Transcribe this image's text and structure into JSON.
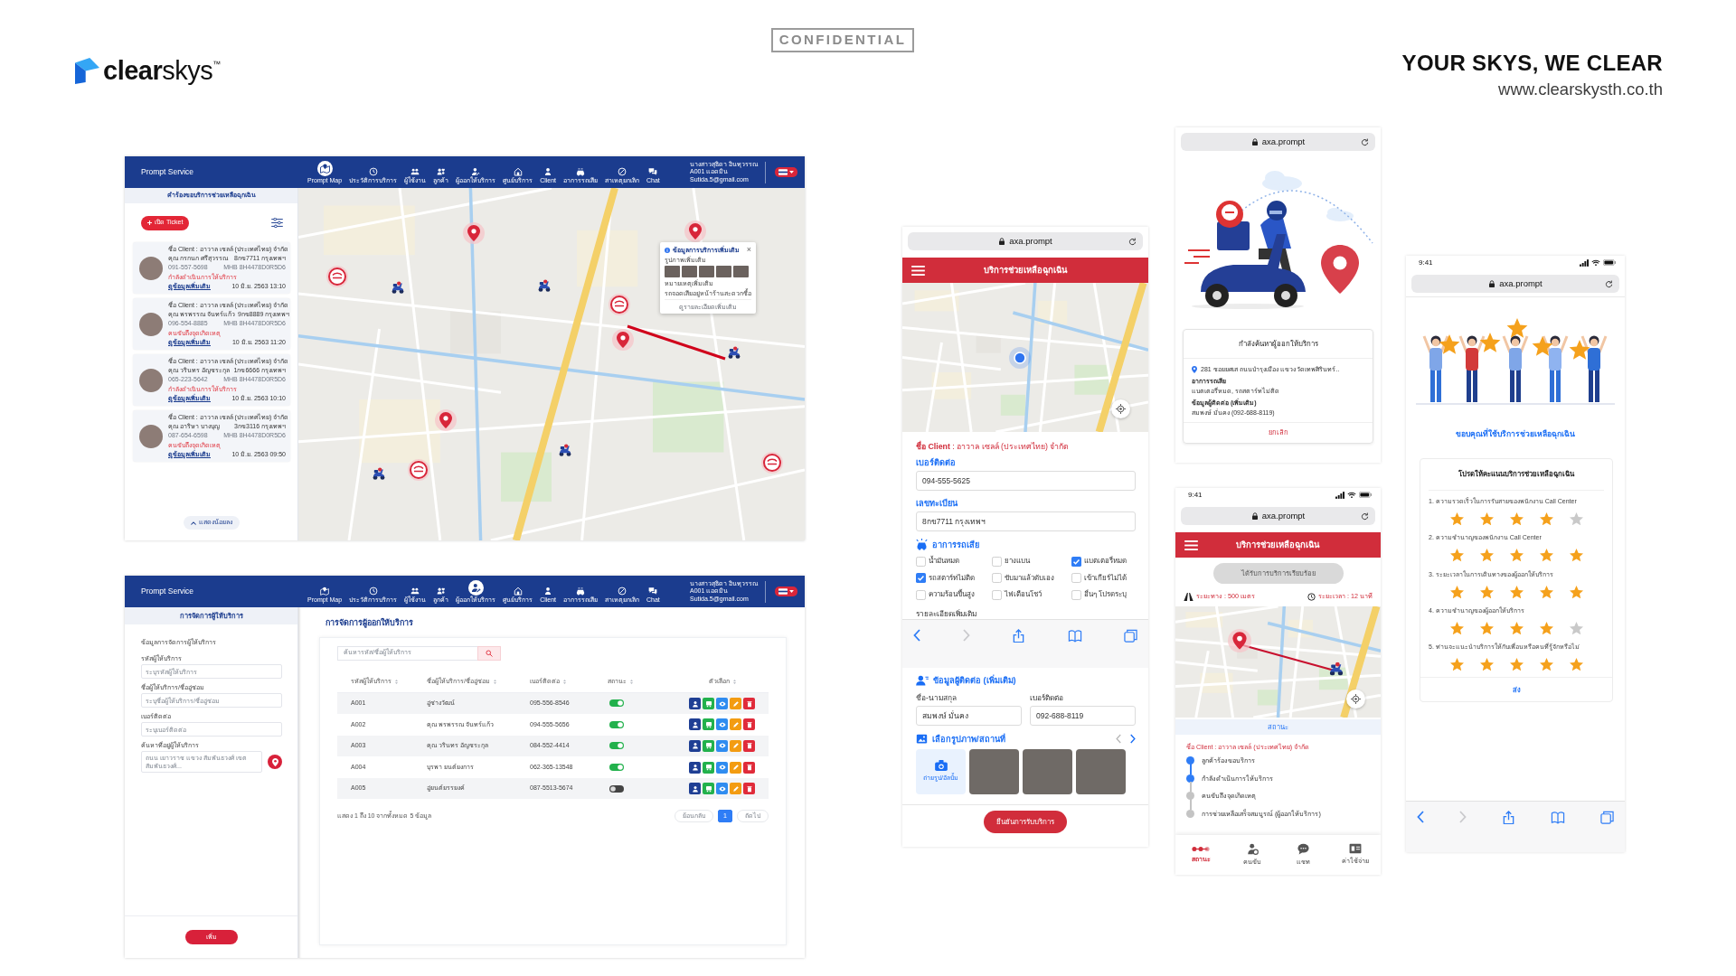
{
  "slide": {
    "logo": "**clear**skys$^{™}$",
    "confidential": "CONFIDENTIAL",
    "tagline": "YOUR SKYS, WE CLEAR",
    "website": "www.clearskysth.co.th"
  },
  "desktop_screens": [
    {
      "kind": "map",
      "app_title": "Prompt Service",
      "nav": [
        {
          "label": "Prompt Map",
          "selected": true
        },
        {
          "label": "ประวัติการบริการ",
          "selected": false
        },
        {
          "label": "ผู้ใช้งาน",
          "selected": false
        },
        {
          "label": "ลูกค้า",
          "selected": false
        },
        {
          "label": "ผู้ออกให้บริการ",
          "selected": false
        },
        {
          "label": "ศูนย์บริการ",
          "selected": false
        },
        {
          "label": "Client",
          "selected": false
        },
        {
          "label": "อาการรถเสีย",
          "selected": false
        },
        {
          "label": "สาเหตุยกเลิก",
          "selected": false
        },
        {
          "label": "Chat",
          "selected": false
        }
      ],
      "user": [
        "นางสาวสุธิดา อินทุวรรณ",
        "A001 แอดมิน",
        "Sutida.5@gmail.com"
      ],
      "sidebar": {
        "title": "คำร้องขอบริการช่วยเหลือฉุกเฉิน",
        "ticket_button": "เปิด Ticket",
        "requests": [
          {
            "client": "ชื่อ Client : อาวาล เซลล์ (ประเทศไทย) จำกัด",
            "name": "คุณ กรกนก ศรีสุวรรณ",
            "plate": "8กข7711 กรุงเทพฯ",
            "phone": "091-557-5698",
            "vin": "MHB 8H4478D0R5D6",
            "status": "กำลังดำเนินการให้บริการ",
            "link": "ดูข้อมูลเพิ่มเติม",
            "date": "10 มิ.ย. 2563 13:10"
          },
          {
            "client": "ชื่อ Client : อาวาล เซลล์ (ประเทศไทย) จำกัด",
            "name": "คุณ พรพรรณ จันทร์แก้ว",
            "plate": "9กข8889 กรุงเทพฯ",
            "phone": "096-554-8885",
            "vin": "MHB 8H4478D0R5D6",
            "status": "คนขับถึงจุดเกิดเหตุ",
            "link": "ดูข้อมูลเพิ่มเติม",
            "date": "10 มิ.ย. 2563 11:20"
          },
          {
            "client": "ชื่อ Client : อาวาล เซลล์ (ประเทศไทย) จำกัด",
            "name": "คุณ วรินทร อัญชระกุล",
            "plate": "1กข6666 กรุงเทพฯ",
            "phone": "065-223-5642",
            "vin": "MHB 8H4478D0R5D6",
            "status": "กำลังดำเนินการให้บริการ",
            "link": "ดูข้อมูลเพิ่มเติม",
            "date": "10 มิ.ย. 2563 10:10"
          },
          {
            "client": "ชื่อ Client : อาวาล เซลล์ (ประเทศไทย) จำกัด",
            "name": "คุณ อาริษา บางบุญ",
            "plate": "3กข3116 กรุงเทพฯ",
            "phone": "087-654-6598",
            "vin": "MHB 8H4478D0R5D6",
            "status": "คนขับถึงจุดเกิดเหตุ",
            "link": "ดูข้อมูลเพิ่มเติม",
            "date": "10 มิ.ย. 2563 09:50"
          }
        ],
        "collapse_button": "แสดงน้อยลง"
      },
      "map_popup": {
        "title": "ข้อมูลการบริการเพิ่มเติม",
        "close": "×",
        "photos_label": "รูปภาพเพิ่มเติม",
        "note_label": "หมายเหตุเพิ่มเติม",
        "note": "รถจอดเสียอยู่หน้าร้านสะดวกซื้อ",
        "link": "ดูรายละเอียดเพิ่มเติม"
      }
    },
    {
      "kind": "providers",
      "app_title": "Prompt Service",
      "nav": [
        {
          "label": "Prompt Map",
          "selected": false
        },
        {
          "label": "ประวัติการบริการ",
          "selected": false
        },
        {
          "label": "ผู้ใช้งาน",
          "selected": false
        },
        {
          "label": "ลูกค้า",
          "selected": false
        },
        {
          "label": "ผู้ออกให้บริการ",
          "selected": true
        },
        {
          "label": "ศูนย์บริการ",
          "selected": false
        },
        {
          "label": "Client",
          "selected": false
        },
        {
          "label": "อาการรถเสีย",
          "selected": false
        },
        {
          "label": "สาเหตุยกเลิก",
          "selected": false
        },
        {
          "label": "Chat",
          "selected": false
        }
      ],
      "user": [
        "นางสาวสุธิดา อินทุวรรณ",
        "A001 แอดมิน",
        "Sutida.5@gmail.com"
      ],
      "sidebar": {
        "title": "การจัดการผู้ให้บริการ",
        "form_title": "ข้อมูลการจัดการผู้ให้บริการ",
        "fields": [
          {
            "label": "รหัสผู้ให้บริการ",
            "placeholder": "ระบุรหัสผู้ให้บริการ"
          },
          {
            "label": "ชื่อผู้ให้บริการ/ชื่ออู่ซ่อม",
            "placeholder": "ระบุชื่อผู้ให้บริการ/ชื่ออู่ซ่อม"
          },
          {
            "label": "เบอร์ติดต่อ",
            "placeholder": "ระบุเบอร์ติดต่อ"
          },
          {
            "label": "ค้นหาที่อยู่ผู้ให้บริการ",
            "placeholder": "ถนน เยาวราช แขวง สัมพันธวงศ์ เขตสัมพันธวงศ์..."
          }
        ],
        "add_button": "เพิ่ม"
      },
      "content": {
        "title": "การจัดการผู้ออกให้บริการ",
        "search_placeholder": "ค้นหารหัส/ชื่อผู้ให้บริการ",
        "columns": [
          "รหัสผู้ให้บริการ",
          "ชื่อผู้ให้บริการ/ชื่ออู่ซ่อม",
          "เบอร์ติดต่อ",
          "สถานะ",
          "ตัวเลือก"
        ],
        "rows": [
          {
            "code": "A001",
            "name": "อู่ช่างวัฒน์",
            "phone": "095-556-8546",
            "on": true
          },
          {
            "code": "A002",
            "name": "คุณ พรพรรณ จันทร์แก้ว",
            "phone": "094-555-5656",
            "on": true
          },
          {
            "code": "A003",
            "name": "คุณ วรินทร อัญชระกุล",
            "phone": "084-552-4414",
            "on": true
          },
          {
            "code": "A004",
            "name": "บุรพา ยนต์ยงการ",
            "phone": "062-365-13548",
            "on": true
          },
          {
            "code": "A005",
            "name": "อู่ยนต์ยรรยงค์",
            "phone": "087-5513-5674",
            "on": false
          }
        ],
        "summary": "แสดง 1 ถึง 10 จากทั้งหมด 5 ข้อมูล",
        "pagination": [
          {
            "label": "ย้อนกลับ",
            "selected": false
          },
          {
            "label": "1",
            "selected": true
          },
          {
            "label": "ถัดไป",
            "selected": false
          }
        ]
      }
    }
  ],
  "phones": [
    {
      "kind": "request_form",
      "url": "axa.prompt",
      "app_bar_title": "บริการช่วยเหลือฉุกเฉิน",
      "client": "**ชื่อ Client** : อาวาล เซลล์ (ประเทศไทย) จำกัด",
      "fields": [
        {
          "label": "เบอร์ติดต่อ",
          "value": "094-555-5625"
        },
        {
          "label": "เลขทะเบียน",
          "value": "8กข7711 กรุงเทพฯ"
        }
      ],
      "symptoms": {
        "title": "อาการรถเสีย",
        "options": [
          {
            "label": "น้ำมันหมด",
            "checked": false
          },
          {
            "label": "ยางแบน",
            "checked": false
          },
          {
            "label": "แบตเตอรี่หมด",
            "checked": true
          },
          {
            "label": "รถสตาร์ทไม่ติด",
            "checked": true
          },
          {
            "label": "ขับมาแล้วดับเอง",
            "checked": false
          },
          {
            "label": "เข้าเกียร์ไม่ได้",
            "checked": false
          },
          {
            "label": "ความร้อนขึ้นสูง",
            "checked": false
          },
          {
            "label": "ไฟเตือนโชว์",
            "checked": false
          },
          {
            "label": "อื่นๆ โปรดระบุ",
            "checked": false
          }
        ]
      },
      "details_label": "รายละเอียดเพิ่มเติม",
      "contact": {
        "title": "ข้อมูลผู้ติดต่อ (เพิ่มเติม)",
        "fields": [
          {
            "label": "ชื่อ-นามสกุล",
            "value": "สมพงษ์ มั่นคง"
          },
          {
            "label": "เบอร์ติดต่อ",
            "value": "092-688-8119"
          }
        ]
      },
      "photos": {
        "title": "เลือกรูปภาพ/สถานที่",
        "upload": "ถ่ายรูป/อัลบั้ม"
      },
      "confirm_button": "ยืนยันการรับบริการ"
    },
    {
      "kind": "searching",
      "url": "axa.prompt",
      "card": {
        "title": "กำลังค้นหาผู้ออกให้บริการ",
        "address": "281 ซอยยศเส ถนนบำรุงเมือง แขวง วัดเทพศิรินทร์..",
        "sections": [
          {
            "label": "อาการรถเสีย",
            "value": "แบตเตอรี่หมด, รถสตาร์ทไม่ติด"
          },
          {
            "label": "ข้อมูลผู้ติดต่อ (เพิ่มเติม)",
            "value": "สมพงษ์ มั่นคง (092-688-8119)"
          }
        ],
        "cancel": "ยกเลิก"
      }
    },
    {
      "kind": "tracking",
      "time": "9:41",
      "url": "axa.prompt",
      "app_bar_title": "บริการช่วยเหลือฉุกเฉิน",
      "done_button": {
        "label": "ได้รับการบริการเรียบร้อย",
        "disabled": true
      },
      "distance": "ระยะทาง : 500 เมตร",
      "duration": "ระยะเวลา : 12 นาที",
      "status_title": "สถานะ",
      "client": "ชื่อ Client : อาวาล เซลล์ (ประเทศไทย) จำกัด",
      "steps": [
        {
          "label": "ลูกค้าร้องขอบริการ",
          "done": true
        },
        {
          "label": "กำลังดำเนินการให้บริการ",
          "done": true
        },
        {
          "label": "คนขับถึงจุดเกิดเหตุ",
          "done": false
        },
        {
          "label": "การช่วยเหลือเสร็จสมบูรณ์ (ผู้ออกให้บริการ)",
          "done": false
        }
      ],
      "tabs": [
        {
          "label": "สถานะ",
          "selected": true
        },
        {
          "label": "คนขับ",
          "selected": false
        },
        {
          "label": "แชท",
          "selected": false
        },
        {
          "label": "ค่าใช้จ่าย",
          "selected": false
        }
      ]
    },
    {
      "kind": "rating",
      "time": "9:41",
      "url": "axa.prompt",
      "thanks": "ขอบคุณที่ใช้บริการช่วยเหลือฉุกเฉิน",
      "survey": {
        "title": "โปรดให้คะแนนบริการช่วยเหลือฉุกเฉิน",
        "questions": [
          {
            "text": "1. ความรวดเร็วในการรับสายของพนักงาน Call Center",
            "stars": 4
          },
          {
            "text": "2. ความชำนาญของพนักงาน Call Center",
            "stars": 5
          },
          {
            "text": "3. ระยะเวลาในการเดินทางของผู้ออกให้บริการ",
            "stars": 5
          },
          {
            "text": "4. ความชำนาญของผู้ออกให้บริการ",
            "stars": 4
          },
          {
            "text": "5. ท่านจะแนะนำบริการให้กับเพื่อนหรือคนที่รู้จักหรือไม่",
            "stars": 5
          }
        ],
        "submit": "ส่ง"
      }
    }
  ]
}
